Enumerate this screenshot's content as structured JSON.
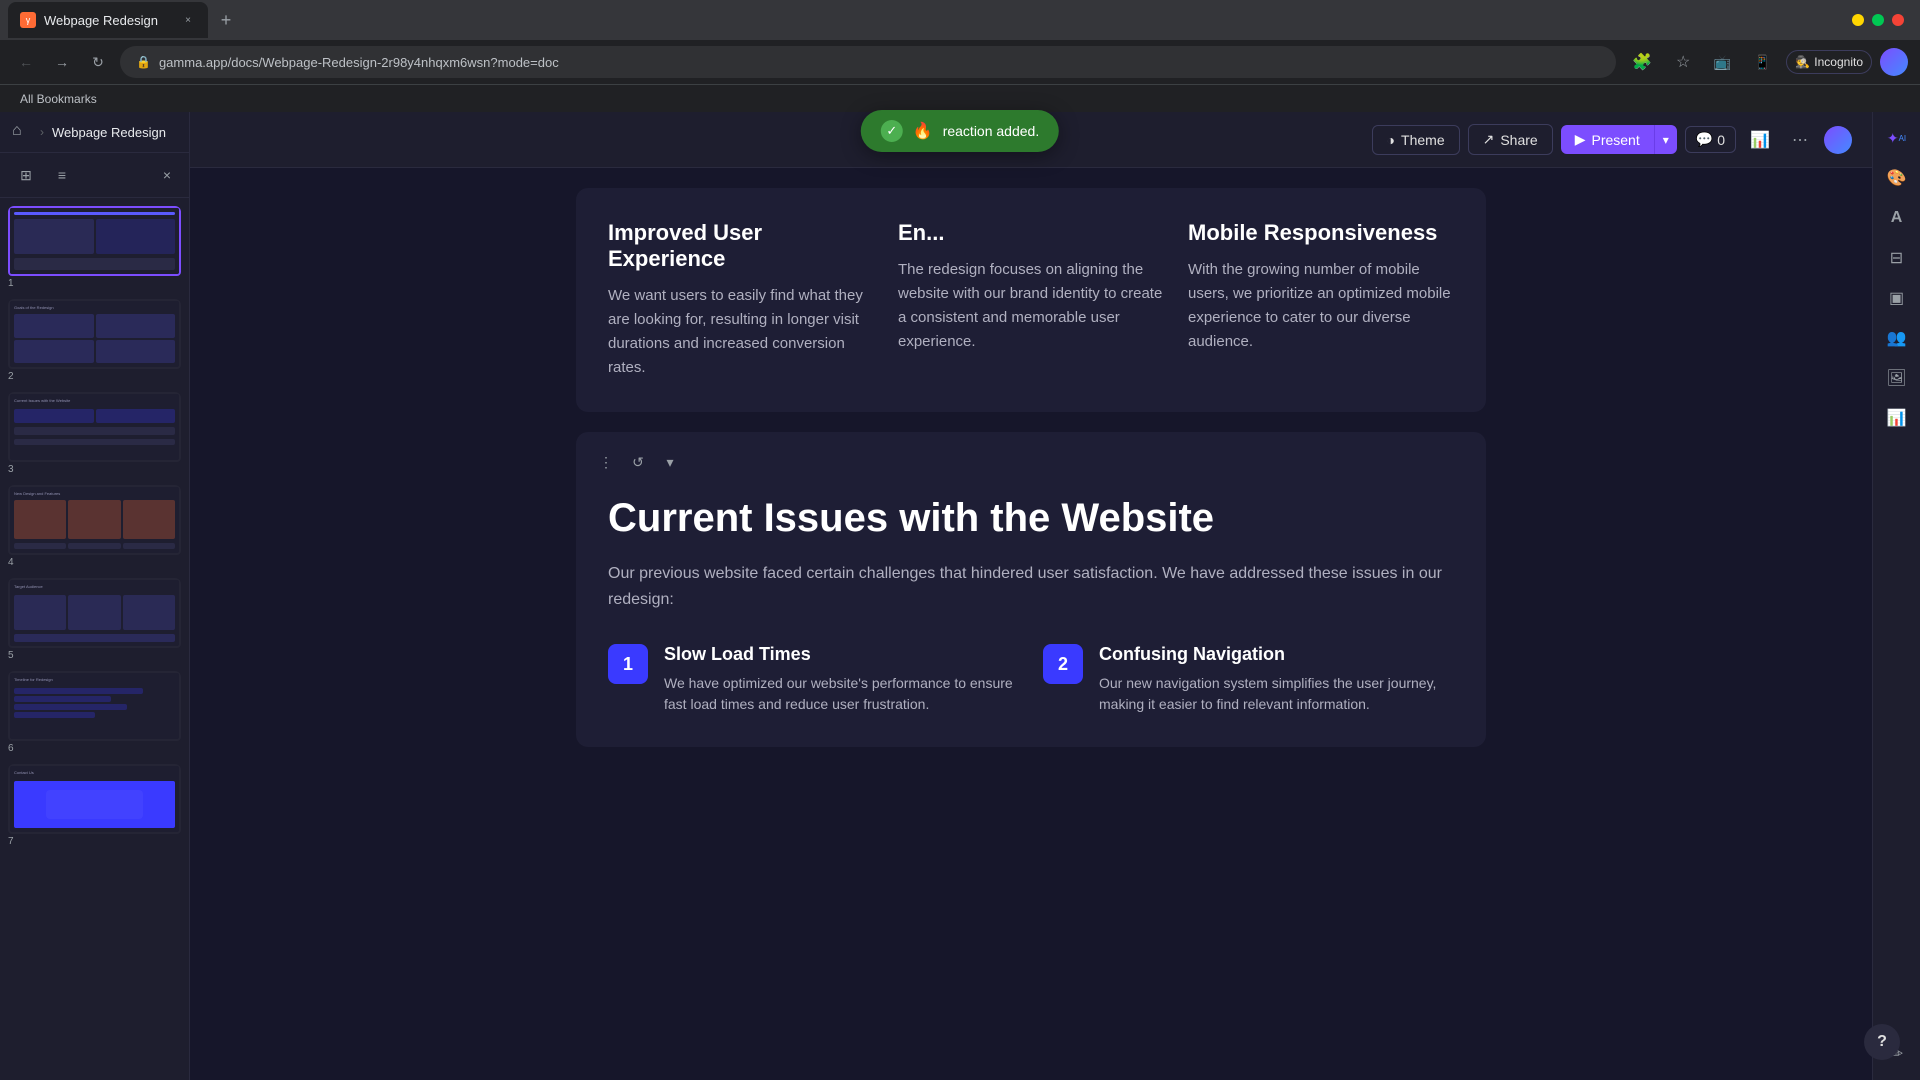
{
  "browser": {
    "tab_title": "Webpage Redesign",
    "url": "gamma.app/docs/Webpage-Redesign-2r98y4nhqxm6wsn?mode=doc",
    "bookmarks_label": "All Bookmarks",
    "incognito_label": "Incognito"
  },
  "sidebar": {
    "title": "Webpage Redesign",
    "slides": [
      {
        "num": "1",
        "active": true
      },
      {
        "num": "2",
        "active": false,
        "label": "Goals of the Redesign"
      },
      {
        "num": "3",
        "active": false,
        "label": "Current Issues with the Website"
      },
      {
        "num": "4",
        "active": false,
        "label": "New Design and Features"
      },
      {
        "num": "5",
        "active": false,
        "label": "Target Audience"
      },
      {
        "num": "6",
        "active": false,
        "label": "Timeline for Redesign"
      },
      {
        "num": "7",
        "active": false,
        "label": "Contact Us"
      }
    ]
  },
  "toolbar": {
    "theme_label": "Theme",
    "share_label": "Share",
    "present_label": "Present",
    "comment_count": "0"
  },
  "toast": {
    "message": "reaction added.",
    "emoji": "🔥",
    "check": "✓"
  },
  "upper_card": {
    "col1": {
      "title": "Improved User Experience",
      "body": "We want users to easily find what they are looking for, resulting in longer visit durations and increased conversion rates."
    },
    "col2": {
      "title": "En...",
      "body": "The redesign focuses on aligning the website with our brand identity to create a consistent and memorable user experience."
    },
    "col3": {
      "title": "Mobile Responsiveness",
      "body": "With the growing number of mobile users, we prioritize an optimized mobile experience to cater to our diverse audience."
    }
  },
  "issue_card": {
    "title": "Current Issues with the Website",
    "description": "Our previous website faced certain challenges that hindered user satisfaction. We have addressed these issues in our redesign:",
    "issues": [
      {
        "num": "1",
        "title": "Slow Load Times",
        "body": "We have optimized our website's performance to ensure fast load times and reduce user frustration."
      },
      {
        "num": "2",
        "title": "Confusing Navigation",
        "body": "Our new navigation system simplifies the user journey, making it easier to find relevant information."
      }
    ]
  },
  "icons": {
    "home": "⌂",
    "grid_view": "⊞",
    "list_view": "≡",
    "close": "×",
    "dots": "⋮",
    "refresh_icon": "↻",
    "theme_icon": "◑",
    "share_icon": "↗",
    "present_icon": "▶",
    "chevron_down": "▾",
    "comment_icon": "💬",
    "chart_icon": "📊",
    "more_icon": "⋯",
    "ai_icon": "✦",
    "grid_icon": "⊞",
    "text_icon": "A",
    "table_icon": "⊟",
    "card_icon": "▣",
    "people_icon": "👥",
    "image_icon": "🖼",
    "chart2_icon": "📈",
    "edit_icon": "✏",
    "back_icon": "←",
    "forward_icon": "→",
    "reload_icon": "↻",
    "card_dots": "⋮",
    "card_rotate": "↺",
    "help_icon": "?"
  },
  "colors": {
    "accent": "#7c4dff",
    "issue_num_bg": "#3a3aff",
    "toast_bg": "#2d7a2d",
    "card_bg": "#1e1e35"
  }
}
